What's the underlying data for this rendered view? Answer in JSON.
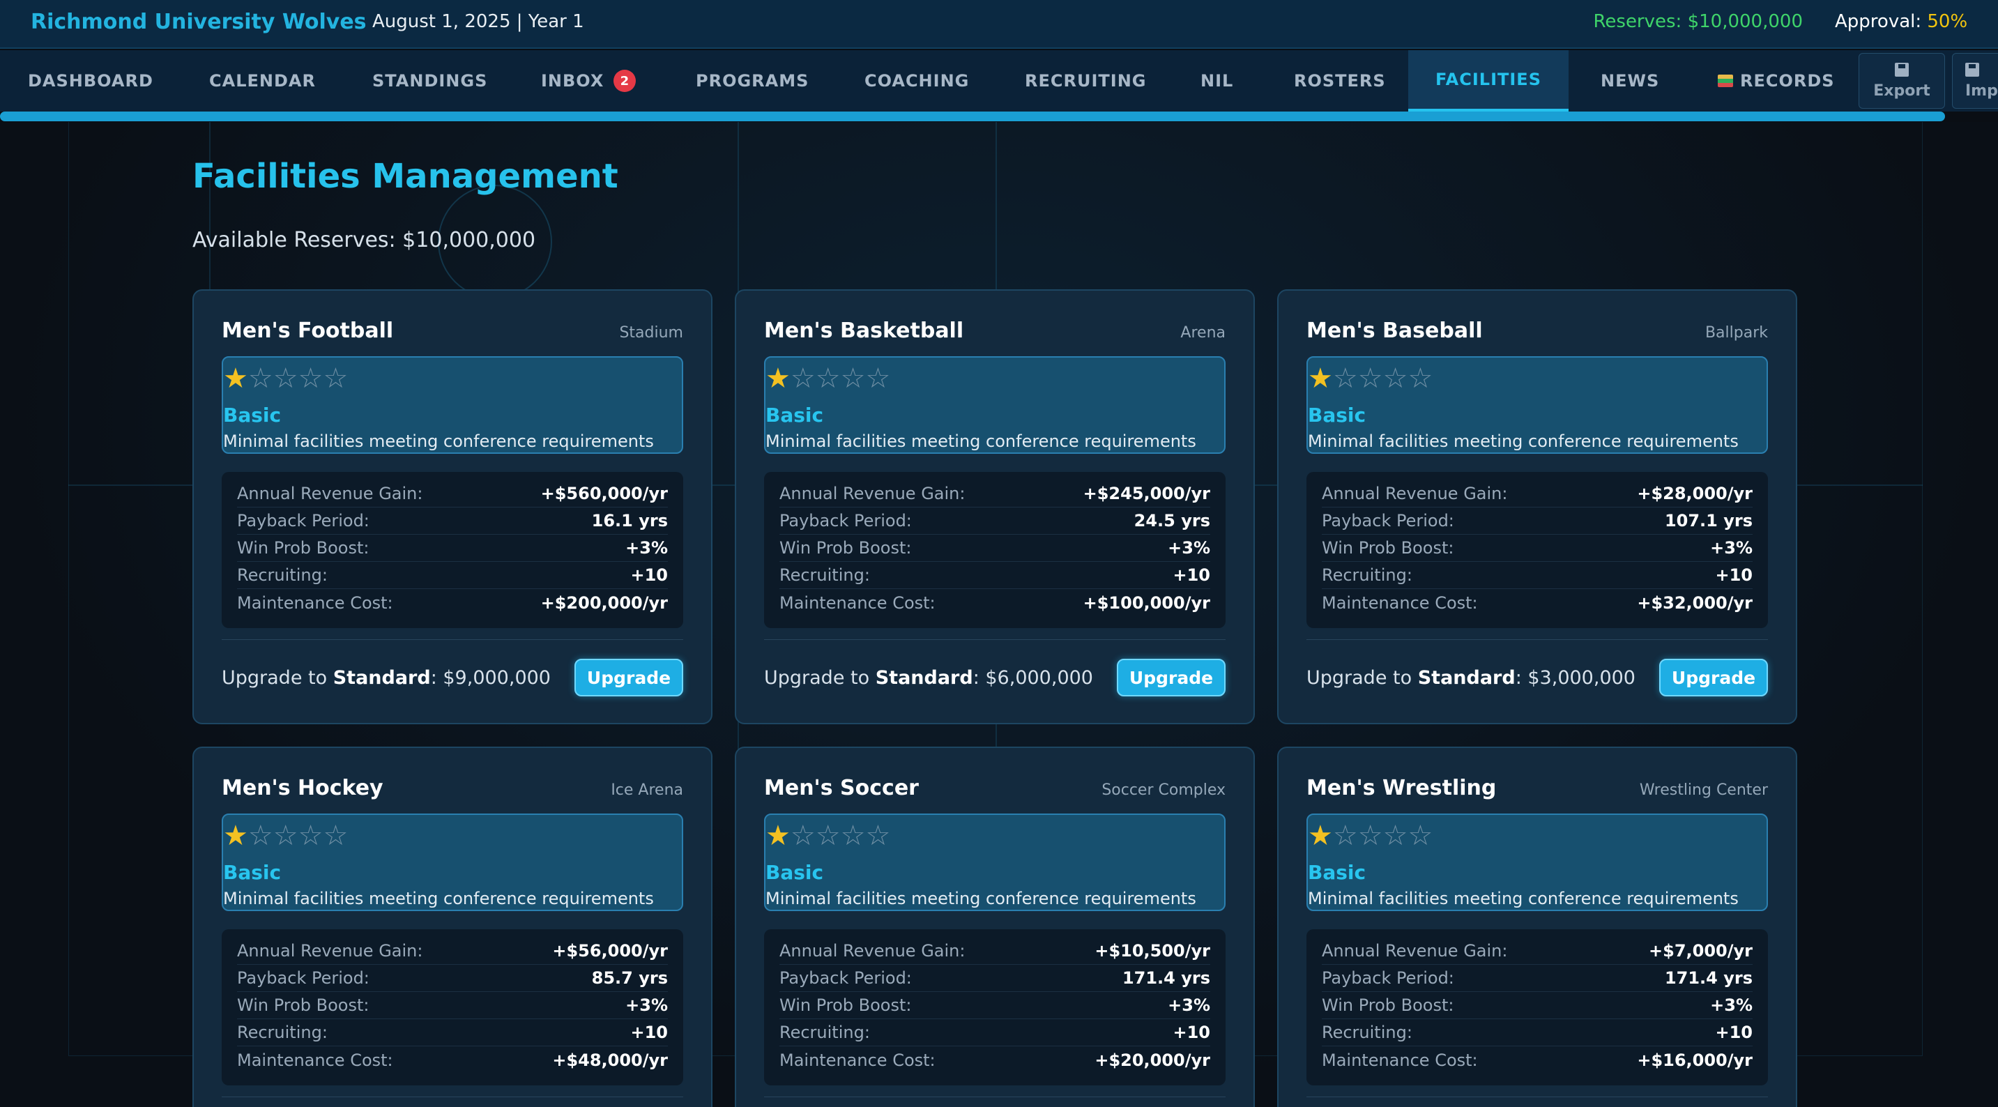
{
  "header": {
    "team_name": "Richmond University Wolves",
    "date_line": "August 1, 2025 | Year 1",
    "reserves_label": "Reserves: $10,000,000",
    "approval_label": "Approval:",
    "approval_value": "50%"
  },
  "nav": {
    "tabs": [
      {
        "label": "DASHBOARD"
      },
      {
        "label": "CALENDAR"
      },
      {
        "label": "STANDINGS"
      },
      {
        "label": "INBOX",
        "badge": "2"
      },
      {
        "label": "PROGRAMS"
      },
      {
        "label": "COACHING"
      },
      {
        "label": "RECRUITING"
      },
      {
        "label": "NIL"
      },
      {
        "label": "ROSTERS"
      },
      {
        "label": "FACILITIES",
        "active": true
      },
      {
        "label": "NEWS"
      },
      {
        "label": "RECORDS",
        "icon": "books-icon"
      }
    ],
    "export_label": "Export",
    "import_label": "Imp"
  },
  "page": {
    "title": "Facilities Management",
    "available_reserves": "Available Reserves: $10,000,000"
  },
  "stat_labels": {
    "revenue": "Annual Revenue Gain:",
    "payback": "Payback Period:",
    "win": "Win Prob Boost:",
    "recruiting": "Recruiting:",
    "maintenance": "Maintenance Cost:"
  },
  "upgrade": {
    "prefix": "Upgrade to ",
    "button_label": "Upgrade"
  },
  "stars": {
    "filled": "★",
    "empty": "☆☆☆☆",
    "rating": 1,
    "max": 5
  },
  "facilities": [
    {
      "sport": "Men's Football",
      "venue": "Stadium",
      "level": "Basic",
      "description": "Minimal facilities meeting conference requirements",
      "revenue": "+$560,000/yr",
      "payback": "16.1 yrs",
      "win": "+3%",
      "recruiting": "+10",
      "maintenance": "+$200,000/yr",
      "next_level": "Standard",
      "cost": ": $9,000,000"
    },
    {
      "sport": "Men's Basketball",
      "venue": "Arena",
      "level": "Basic",
      "description": "Minimal facilities meeting conference requirements",
      "revenue": "+$245,000/yr",
      "payback": "24.5 yrs",
      "win": "+3%",
      "recruiting": "+10",
      "maintenance": "+$100,000/yr",
      "next_level": "Standard",
      "cost": ": $6,000,000"
    },
    {
      "sport": "Men's Baseball",
      "venue": "Ballpark",
      "level": "Basic",
      "description": "Minimal facilities meeting conference requirements",
      "revenue": "+$28,000/yr",
      "payback": "107.1 yrs",
      "win": "+3%",
      "recruiting": "+10",
      "maintenance": "+$32,000/yr",
      "next_level": "Standard",
      "cost": ": $3,000,000"
    },
    {
      "sport": "Men's Hockey",
      "venue": "Ice Arena",
      "level": "Basic",
      "description": "Minimal facilities meeting conference requirements",
      "revenue": "+$56,000/yr",
      "payback": "85.7 yrs",
      "win": "+3%",
      "recruiting": "+10",
      "maintenance": "+$48,000/yr"
    },
    {
      "sport": "Men's Soccer",
      "venue": "Soccer Complex",
      "level": "Basic",
      "description": "Minimal facilities meeting conference requirements",
      "revenue": "+$10,500/yr",
      "payback": "171.4 yrs",
      "win": "+3%",
      "recruiting": "+10",
      "maintenance": "+$20,000/yr"
    },
    {
      "sport": "Men's Wrestling",
      "venue": "Wrestling Center",
      "level": "Basic",
      "description": "Minimal facilities meeting conference requirements",
      "revenue": "+$7,000/yr",
      "payback": "171.4 yrs",
      "win": "+3%",
      "recruiting": "+10",
      "maintenance": "+$16,000/yr"
    }
  ]
}
